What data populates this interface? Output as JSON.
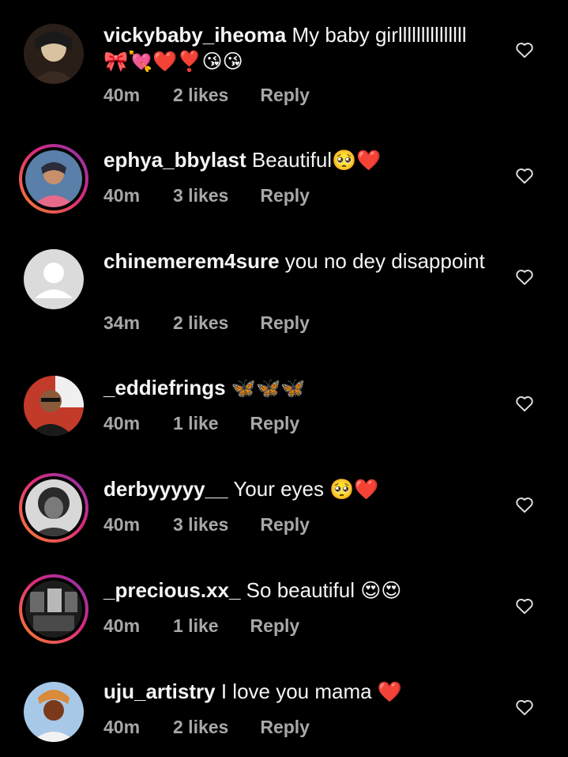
{
  "comments": [
    {
      "username": "vickybaby_iheoma",
      "text": "My baby girlllllllllllllll",
      "emojis": "🎀💘❤️❣️😘😘",
      "time": "40m",
      "likes": "2 likes",
      "reply": "Reply",
      "avatar_colors": [
        "#3a2a22",
        "#d9c2a0",
        "#1a1a1a"
      ],
      "story_ring": false
    },
    {
      "username": "ephya_bbylast",
      "text": "Beautiful",
      "emojis": "🥺❤️",
      "time": "40m",
      "likes": "3 likes",
      "reply": "Reply",
      "avatar_colors": [
        "#5a7fa8",
        "#e86a8a",
        "#2b2b3a"
      ],
      "story_ring": true
    },
    {
      "username": "chinemerem4sure",
      "text": "you no dey disappoint",
      "emojis": "",
      "time": "34m",
      "likes": "2 likes",
      "reply": "Reply",
      "avatar_colors": [
        "#dbdbdb",
        "#ffffff",
        "#dbdbdb"
      ],
      "story_ring": false,
      "default_avatar": true
    },
    {
      "username": "_eddiefrings",
      "text": "",
      "emojis": "🦋🦋🦋",
      "time": "40m",
      "likes": "1 like",
      "reply": "Reply",
      "avatar_colors": [
        "#8a5a3a",
        "#f0f0f0",
        "#c23a2a"
      ],
      "story_ring": false
    },
    {
      "username": "derbyyyyy__",
      "text": "Your eyes",
      "emojis": "🥺❤️",
      "time": "40m",
      "likes": "3 likes",
      "reply": "Reply",
      "avatar_colors": [
        "#9a9a9a",
        "#2a2a2a",
        "#d8d8d8"
      ],
      "story_ring": true
    },
    {
      "username": "_precious.xx_",
      "text": "So beautiful",
      "emojis": "😍😍",
      "time": "40m",
      "likes": "1 like",
      "reply": "Reply",
      "avatar_colors": [
        "#6a6a6a",
        "#1c1c1c",
        "#b8b8b8"
      ],
      "story_ring": true
    },
    {
      "username": "uju_artistry",
      "text": "I love you mama",
      "emojis": "❤️",
      "time": "40m",
      "likes": "2 likes",
      "reply": "Reply",
      "avatar_colors": [
        "#d98a3a",
        "#7a3a1a",
        "#a8c8e8"
      ],
      "story_ring": false
    }
  ],
  "colors": {
    "background": "#000000",
    "text": "#f5f5f5",
    "meta": "#a8a8a8",
    "heart_outline": "#e0e0e0"
  },
  "icons": {
    "like": "heart-outline-icon"
  }
}
